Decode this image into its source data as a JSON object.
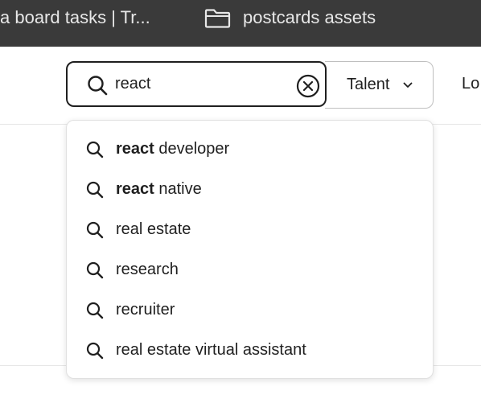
{
  "bookmarks": {
    "item1": "a board tasks | Tr...",
    "item2": "postcards assets",
    "item2_icon": "folder-icon"
  },
  "search": {
    "value": "react",
    "icon": "search-icon",
    "clear_icon": "clear-circle-x-icon"
  },
  "category_select": {
    "selected": "Talent",
    "icon": "chevron-down-icon"
  },
  "header": {
    "login_partial": "Lo"
  },
  "suggestions": [
    {
      "bold": "react",
      "rest": " developer"
    },
    {
      "bold": "react",
      "rest": " native"
    },
    {
      "bold": "",
      "rest": "real estate"
    },
    {
      "bold": "",
      "rest": "research"
    },
    {
      "bold": "",
      "rest": "recruiter"
    },
    {
      "bold": "",
      "rest": "real estate virtual assistant"
    }
  ],
  "colors": {
    "bookmarks_bar_bg": "#3a3a3a",
    "text": "#1f1f1f",
    "border_active": "#1f1f1f",
    "border": "#bfbfbf"
  }
}
